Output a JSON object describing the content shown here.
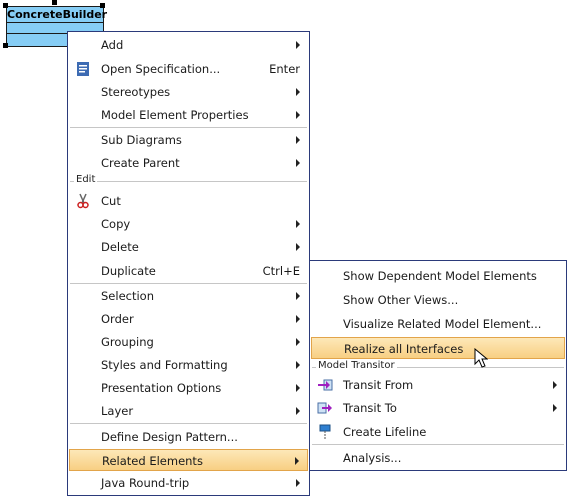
{
  "diagram": {
    "class_name": "ConcreteBuilder"
  },
  "context_menu": {
    "items": {
      "add": {
        "label": "Add",
        "arrow": true
      },
      "open_spec": {
        "label": "Open Specification...",
        "shortcut": "Enter",
        "icon": "open-spec-icon"
      },
      "stereotypes": {
        "label": "Stereotypes",
        "arrow": true
      },
      "model_props": {
        "label": "Model Element Properties",
        "arrow": true
      },
      "sub_diagrams": {
        "label": "Sub Diagrams",
        "arrow": true
      },
      "create_parent": {
        "label": "Create Parent",
        "arrow": true
      },
      "cut": {
        "label": "Cut",
        "icon": "scissors-icon"
      },
      "copy": {
        "label": "Copy",
        "arrow": true
      },
      "delete": {
        "label": "Delete",
        "arrow": true
      },
      "duplicate": {
        "label": "Duplicate",
        "shortcut": "Ctrl+E"
      },
      "selection": {
        "label": "Selection",
        "arrow": true
      },
      "order": {
        "label": "Order",
        "arrow": true
      },
      "grouping": {
        "label": "Grouping",
        "arrow": true
      },
      "styles": {
        "label": "Styles and Formatting",
        "arrow": true
      },
      "presentation": {
        "label": "Presentation Options",
        "arrow": true
      },
      "layer": {
        "label": "Layer",
        "arrow": true
      },
      "design_pattern": {
        "label": "Define Design Pattern..."
      },
      "related": {
        "label": "Related Elements",
        "arrow": true,
        "highlighted": true
      },
      "java": {
        "label": "Java Round-trip",
        "arrow": true
      }
    },
    "group_edit": "Edit"
  },
  "submenu": {
    "items": {
      "show_dependent": {
        "label": "Show Dependent Model Elements"
      },
      "show_other": {
        "label": "Show Other Views..."
      },
      "visualize": {
        "label": "Visualize Related Model Element..."
      },
      "realize": {
        "label": "Realize all Interfaces",
        "highlighted": true
      },
      "transit_from": {
        "label": "Transit From",
        "arrow": true,
        "icon": "transit-from-icon"
      },
      "transit_to": {
        "label": "Transit To",
        "arrow": true,
        "icon": "transit-to-icon"
      },
      "lifeline": {
        "label": "Create Lifeline",
        "icon": "lifeline-icon"
      },
      "analysis": {
        "label": "Analysis..."
      }
    },
    "group_transitor": "Model Transitor"
  },
  "colors": {
    "highlight_top": "#fde8b8",
    "highlight_bottom": "#f8cf83",
    "class_fill": "#86cdf5",
    "menu_border": "#2b3a7a"
  }
}
